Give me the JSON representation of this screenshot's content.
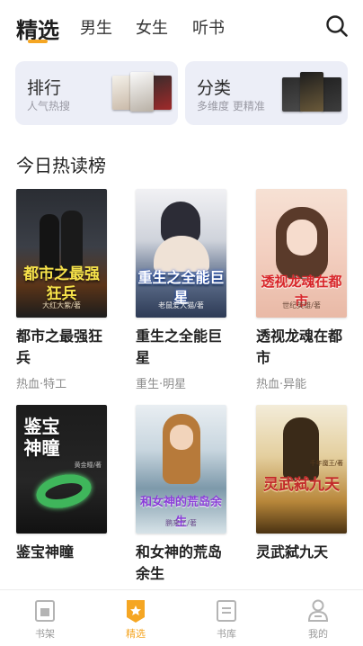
{
  "header": {
    "tabs": [
      {
        "label": "精选",
        "active": true
      },
      {
        "label": "男生",
        "active": false
      },
      {
        "label": "女生",
        "active": false
      },
      {
        "label": "听书",
        "active": false
      }
    ],
    "search_icon": "search-icon",
    "accent_color": "#f5a623"
  },
  "cards": [
    {
      "title": "排行",
      "subtitle": "人气热搜"
    },
    {
      "title": "分类",
      "subtitle": "多维度 更精准"
    }
  ],
  "section": {
    "title": "今日热读榜"
  },
  "books": [
    {
      "title": "都市之最强狂兵",
      "tags": "热血·特工",
      "cover_text": "都市之最强狂兵",
      "cover_author": "大红大紫/著"
    },
    {
      "title": "重生之全能巨星",
      "tags": "重生·明星",
      "cover_text": "重生之全能巨星",
      "cover_author": "老鼠爱大猫/著"
    },
    {
      "title": "透视龙魂在都市",
      "tags": "热血·异能",
      "cover_text": "透视龙魂在都市",
      "cover_author": "世纪英雄/著"
    },
    {
      "title": "鉴宝神瞳",
      "tags": "",
      "cover_text": "鉴宝神瞳",
      "cover_author": "黄金瞳/著"
    },
    {
      "title": "和女神的荒岛余生",
      "tags": "",
      "cover_text": "和女神的荒岛余生",
      "cover_author": "鹏来了/著"
    },
    {
      "title": "灵武弑九天",
      "tags": "",
      "cover_text": "灵武弑九天",
      "cover_author": "千年魔王/著"
    }
  ],
  "bottom_nav": [
    {
      "label": "书架",
      "icon": "bookshelf-icon",
      "active": false
    },
    {
      "label": "精选",
      "icon": "featured-icon",
      "active": true
    },
    {
      "label": "书库",
      "icon": "library-icon",
      "active": false
    },
    {
      "label": "我的",
      "icon": "profile-icon",
      "active": false
    }
  ]
}
